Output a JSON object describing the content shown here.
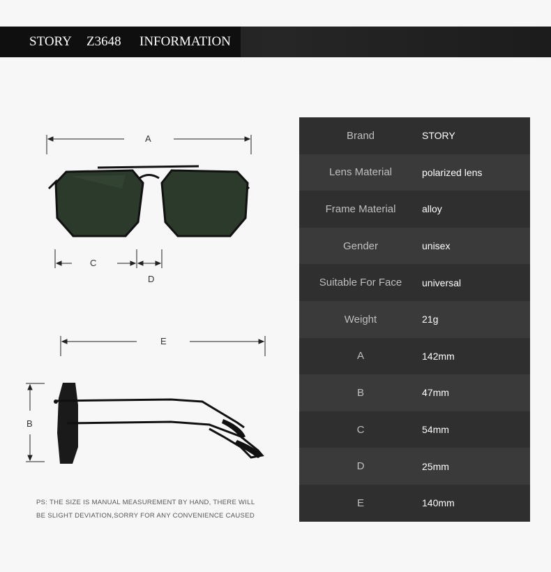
{
  "header": {
    "brand": "STORY",
    "model": "Z3648",
    "section": "INFORMATION"
  },
  "dimension_labels": {
    "a": "A",
    "b": "B",
    "c": "C",
    "d": "D",
    "e": "E"
  },
  "note": {
    "line1": "PS: THE SIZE IS MANUAL MEASUREMENT BY HAND, THERE WILL",
    "line2": "BE SLIGHT DEVIATION,SORRY FOR ANY CONVENIENCE CAUSED"
  },
  "specs": [
    {
      "label": "Brand",
      "value": "STORY"
    },
    {
      "label": "Lens Material",
      "value": "polarized lens"
    },
    {
      "label": "Frame Material",
      "value": "alloy"
    },
    {
      "label": "Gender",
      "value": "unisex"
    },
    {
      "label": "Suitable For Face",
      "value": "universal"
    },
    {
      "label": "Weight",
      "value": "21g"
    },
    {
      "label": "A",
      "value": "142mm"
    },
    {
      "label": "B",
      "value": "47mm"
    },
    {
      "label": "C",
      "value": "54mm"
    },
    {
      "label": "D",
      "value": "25mm"
    },
    {
      "label": "E",
      "value": "140mm"
    }
  ],
  "colors": {
    "background": "#f7f7f7",
    "header_bar": "#1a1a1a",
    "table_dark": "#2f2f2f",
    "table_light": "#3a3a3a",
    "lens": "#2b3a2a"
  }
}
